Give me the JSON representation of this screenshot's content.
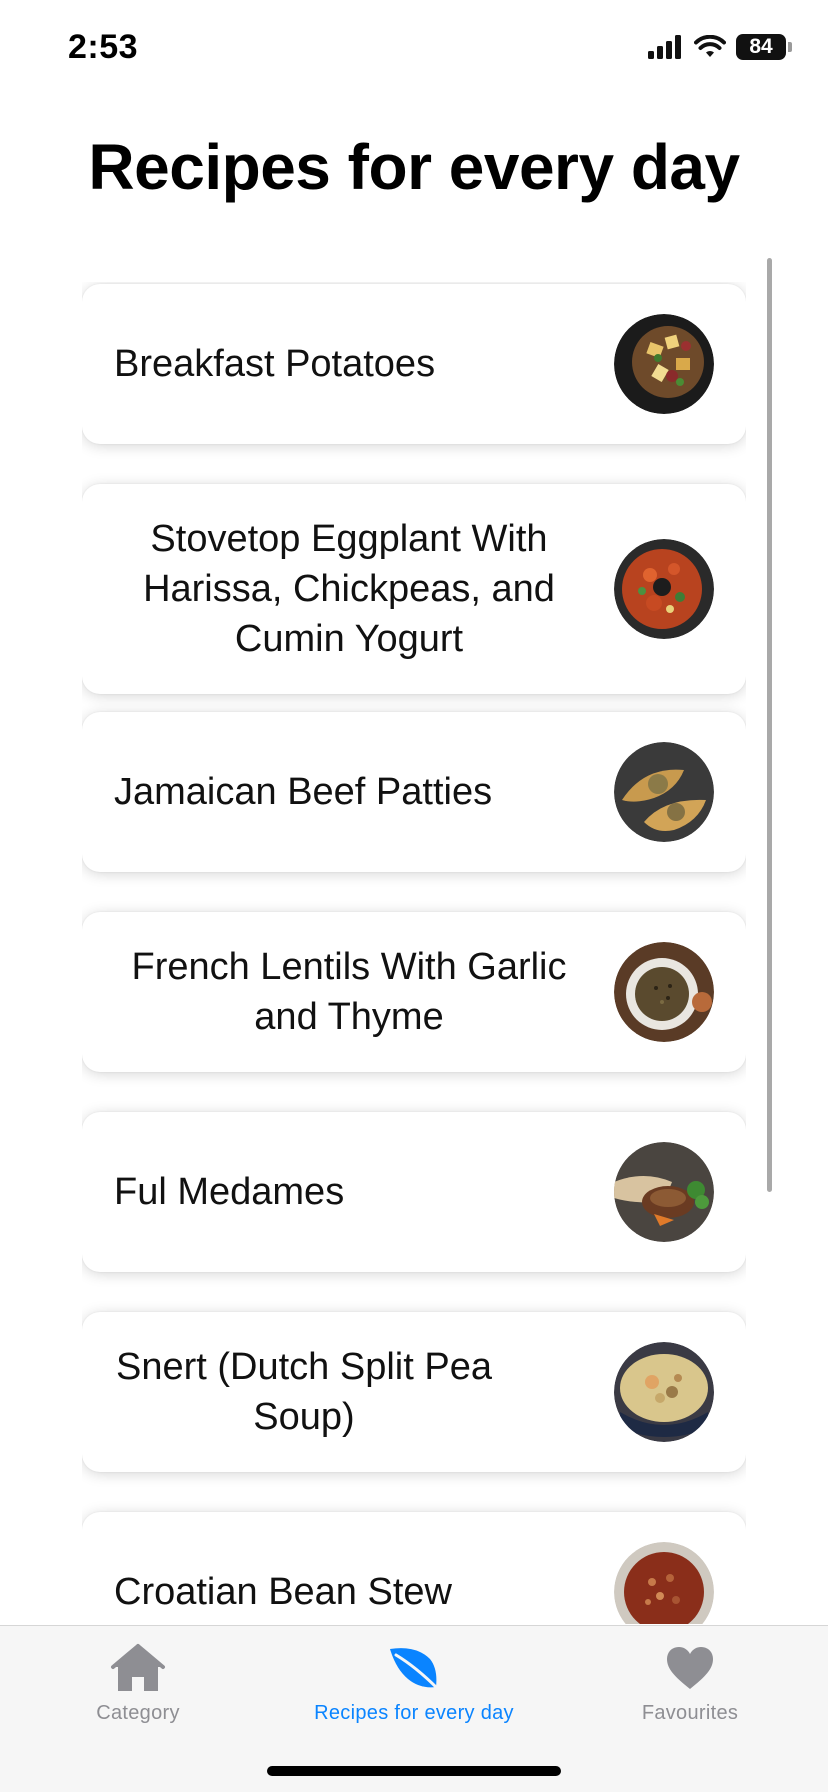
{
  "status": {
    "time": "2:53",
    "battery": "84"
  },
  "title": "Recipes for every day",
  "recipes": [
    {
      "name": "Breakfast Potatoes"
    },
    {
      "name": "Stovetop Eggplant With Harissa, Chickpeas, and Cumin Yogurt"
    },
    {
      "name": "Jamaican Beef Patties"
    },
    {
      "name": "French Lentils With Garlic and Thyme"
    },
    {
      "name": "Ful Medames"
    },
    {
      "name": "Snert (Dutch Split Pea Soup)"
    },
    {
      "name": "Croatian Bean Stew"
    }
  ],
  "tabs": [
    {
      "label": "Category",
      "icon": "house-icon",
      "active": false
    },
    {
      "label": "Recipes for every day",
      "icon": "leaf-icon",
      "active": true
    },
    {
      "label": "Favourites",
      "icon": "heart-icon",
      "active": false
    }
  ],
  "colors": {
    "accent": "#0a84ff",
    "inactive": "#8e8e93",
    "background": "#ffffff"
  }
}
